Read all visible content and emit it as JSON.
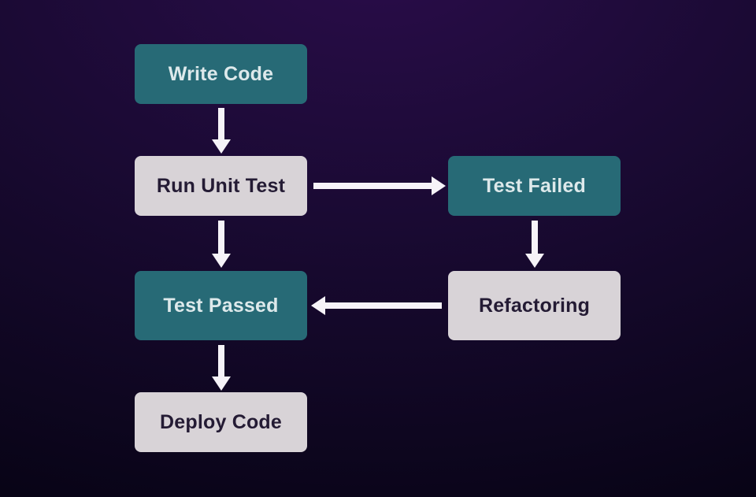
{
  "nodes": {
    "write_code": {
      "label": "Write Code"
    },
    "run_unit_test": {
      "label": "Run Unit Test"
    },
    "test_passed": {
      "label": "Test Passed"
    },
    "deploy_code": {
      "label": "Deploy Code"
    },
    "test_failed": {
      "label": "Test Failed"
    },
    "refactoring": {
      "label": "Refactoring"
    }
  },
  "flow": [
    "write_code -> run_unit_test",
    "run_unit_test -> test_passed",
    "run_unit_test -> test_failed",
    "test_passed -> deploy_code",
    "test_failed -> refactoring",
    "refactoring -> test_passed"
  ],
  "colors": {
    "teal": "#276a76",
    "gray": "#d8d3d7",
    "arrow": "#f6f3f8",
    "bg_top": "#2a0d4a",
    "bg_bottom": "#080416"
  }
}
